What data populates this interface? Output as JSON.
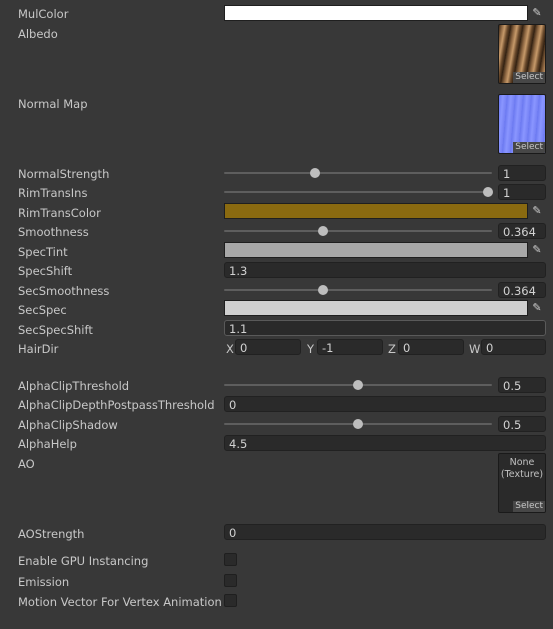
{
  "common": {
    "select_label": "Select",
    "picker_icon": "eyedropper-icon"
  },
  "mulcolor": {
    "label": "MulColor",
    "color": "#ffffff"
  },
  "albedo": {
    "label": "Albedo"
  },
  "normal_map": {
    "label": "Normal Map"
  },
  "normal_strength": {
    "label": "NormalStrength",
    "value": "1",
    "fraction": 0.33
  },
  "rim_trans_ins": {
    "label": "RimTransIns",
    "value": "1",
    "fraction": 0.98
  },
  "rim_trans_color": {
    "label": "RimTransColor",
    "color": "#8a6a10"
  },
  "smoothness": {
    "label": "Smoothness",
    "value": "0.364",
    "fraction": 0.364
  },
  "spec_tint": {
    "label": "SpecTint",
    "color": "#a8a8a8"
  },
  "spec_shift": {
    "label": "SpecShift",
    "value": "1.3"
  },
  "sec_smoothness": {
    "label": "SecSmoothness",
    "value": "0.364",
    "fraction": 0.364
  },
  "sec_spec": {
    "label": "SecSpec",
    "color": "#cfcfcf"
  },
  "sec_spec_shift": {
    "label": "SecSpecShift",
    "value": "1.1"
  },
  "hair_dir": {
    "label": "HairDir",
    "x_label": "X",
    "x": "0",
    "y_label": "Y",
    "y": "-1",
    "z_label": "Z",
    "z": "0",
    "w_label": "W",
    "w": "0"
  },
  "alpha_clip_threshold": {
    "label": "AlphaClipThreshold",
    "value": "0.5",
    "fraction": 0.5
  },
  "alpha_clip_depth": {
    "label": "AlphaClipDepthPostpassThreshold",
    "value": "0"
  },
  "alpha_clip_shadow": {
    "label": "AlphaClipShadow",
    "value": "0.5",
    "fraction": 0.5
  },
  "alpha_help": {
    "label": "AlphaHelp",
    "value": "4.5"
  },
  "ao": {
    "label": "AO",
    "none_text": "None",
    "texture_text": "(Texture)"
  },
  "ao_strength": {
    "label": "AOStrength",
    "value": "0"
  },
  "gpu_instancing": {
    "label": "Enable GPU Instancing",
    "checked": false
  },
  "emission": {
    "label": "Emission",
    "checked": false
  },
  "motion_vector": {
    "label": "Motion Vector For Vertex Animation",
    "checked": false
  }
}
